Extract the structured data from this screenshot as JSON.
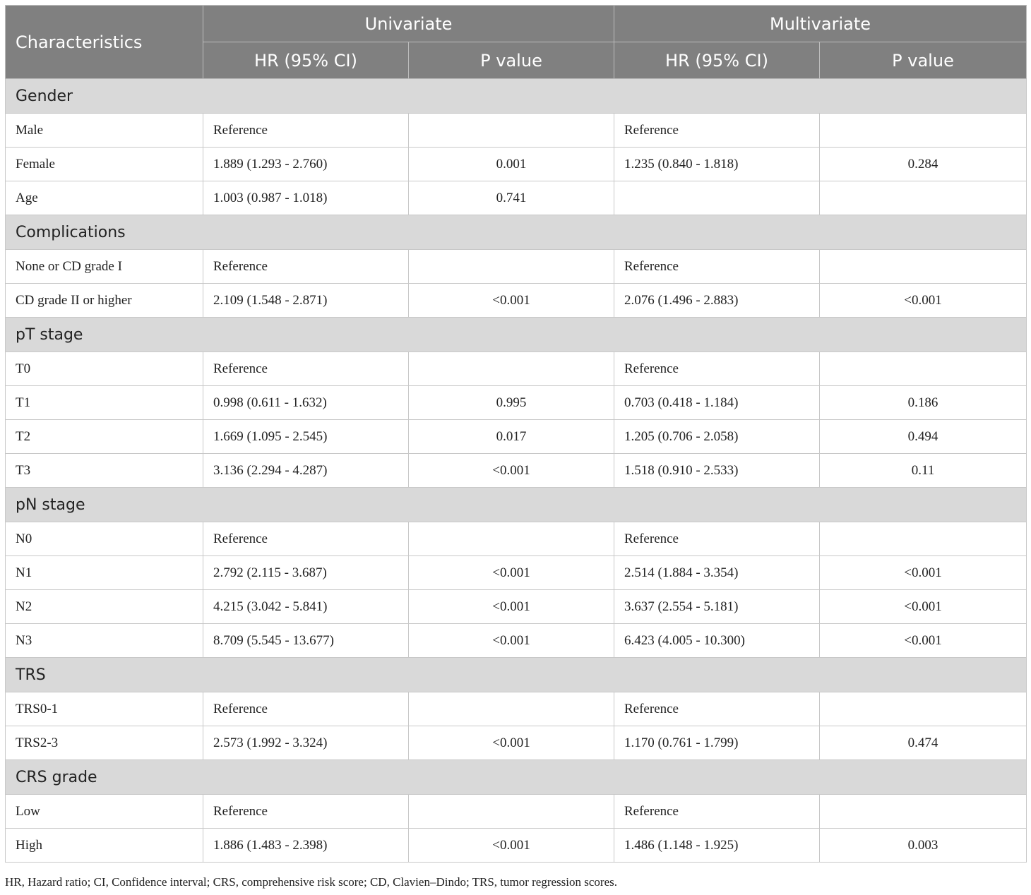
{
  "table": {
    "header": {
      "characteristics": "Characteristics",
      "univariate": "Univariate",
      "multivariate": "Multivariate",
      "hr_label": "HR (95% CI)",
      "p_label": "P value"
    },
    "rows": [
      {
        "type": "section",
        "label": "Gender"
      },
      {
        "type": "data",
        "cells": [
          "Male",
          "Reference",
          "",
          "Reference",
          ""
        ]
      },
      {
        "type": "data",
        "cells": [
          "Female",
          "1.889 (1.293 - 2.760)",
          "0.001",
          "1.235 (0.840 - 1.818)",
          "0.284"
        ]
      },
      {
        "type": "data",
        "cells": [
          "Age",
          "1.003 (0.987 - 1.018)",
          "0.741",
          "",
          ""
        ]
      },
      {
        "type": "section",
        "label": "Complications"
      },
      {
        "type": "data",
        "cells": [
          "None or CD grade I",
          "Reference",
          "",
          "Reference",
          ""
        ]
      },
      {
        "type": "data",
        "cells": [
          "CD grade II or higher",
          "2.109 (1.548 - 2.871)",
          "<0.001",
          "2.076 (1.496 - 2.883)",
          "<0.001"
        ]
      },
      {
        "type": "section",
        "label": "pT stage"
      },
      {
        "type": "data",
        "cells": [
          "T0",
          "Reference",
          "",
          "Reference",
          ""
        ]
      },
      {
        "type": "data",
        "cells": [
          "T1",
          "0.998 (0.611 - 1.632)",
          "0.995",
          "0.703 (0.418 - 1.184)",
          "0.186"
        ]
      },
      {
        "type": "data",
        "cells": [
          "T2",
          "1.669 (1.095 - 2.545)",
          "0.017",
          "1.205 (0.706 - 2.058)",
          "0.494"
        ]
      },
      {
        "type": "data",
        "cells": [
          "T3",
          "3.136 (2.294 - 4.287)",
          "<0.001",
          "1.518 (0.910 - 2.533)",
          "0.11"
        ]
      },
      {
        "type": "section",
        "label": "pN stage"
      },
      {
        "type": "data",
        "cells": [
          "N0",
          "Reference",
          "",
          "Reference",
          ""
        ]
      },
      {
        "type": "data",
        "cells": [
          "N1",
          "2.792 (2.115 - 3.687)",
          "<0.001",
          "2.514 (1.884 - 3.354)",
          "<0.001"
        ]
      },
      {
        "type": "data",
        "cells": [
          "N2",
          "4.215 (3.042 - 5.841)",
          "<0.001",
          "3.637 (2.554 - 5.181)",
          "<0.001"
        ]
      },
      {
        "type": "data",
        "cells": [
          "N3",
          "8.709 (5.545 - 13.677)",
          "<0.001",
          "6.423 (4.005 - 10.300)",
          "<0.001"
        ]
      },
      {
        "type": "section",
        "label": "TRS"
      },
      {
        "type": "data",
        "cells": [
          "TRS0-1",
          "Reference",
          "",
          "Reference",
          ""
        ]
      },
      {
        "type": "data",
        "cells": [
          "TRS2-3",
          "2.573 (1.992 - 3.324)",
          "<0.001",
          "1.170 (0.761 - 1.799)",
          "0.474"
        ]
      },
      {
        "type": "section",
        "label": "CRS grade"
      },
      {
        "type": "data",
        "cells": [
          "Low",
          "Reference",
          "",
          "Reference",
          ""
        ]
      },
      {
        "type": "data",
        "cells": [
          "High",
          "1.886 (1.483 - 2.398)",
          "<0.001",
          "1.486 (1.148 - 1.925)",
          "0.003"
        ]
      }
    ]
  },
  "footnote": "HR, Hazard ratio; CI, Confidence interval; CRS, comprehensive risk score; CD, Clavien–Dindo; TRS, tumor regression scores."
}
